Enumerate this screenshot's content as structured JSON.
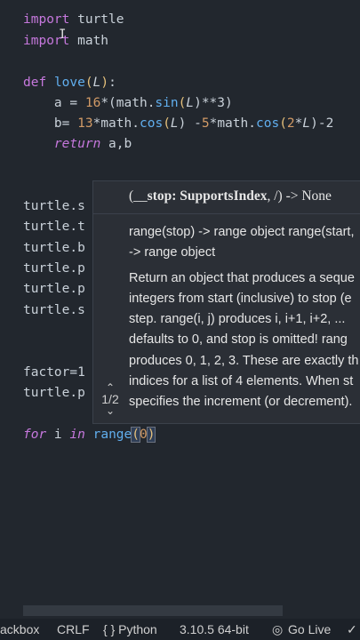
{
  "code": {
    "l1": {
      "kw": "import",
      "mod": " turtle"
    },
    "l2": {
      "kw": "import",
      "mod": " math"
    },
    "l3": {
      "kw": "def",
      "fn": "love",
      "param": "L"
    },
    "l4": {
      "a": "a = ",
      "n16": "16",
      "rest1": "*(math.",
      "sin": "sin",
      "arg": "L",
      "rest2": ")**3)"
    },
    "l5": {
      "b": "b= ",
      "n13": "13",
      "mc1": "*math.",
      "cos1": "cos",
      "arg1": "L",
      "mid": ") -",
      "n5": "5",
      "mc2": "*math.",
      "cos2": "cos",
      "n2": "2",
      "star": "*",
      "arg2": "L",
      "tail": ")-2"
    },
    "l6": {
      "kw": "return",
      "rest": " a,b"
    },
    "t1": "turtle.s",
    "t2": "turtle.t",
    "t3": "turtle.b",
    "t4": "turtle.p",
    "t5": "turtle.p",
    "t6": "turtle.s",
    "f1": "factor=1",
    "t7": "turtle.p",
    "last": {
      "kw1": "for",
      "i": " i ",
      "kw2": "in",
      "fn": " range",
      "arg": "0"
    }
  },
  "hover": {
    "sig_pre": "(__",
    "sig_bold": "stop: SupportsIndex",
    "sig_post": ", /) -> None",
    "lines": [
      "range(stop) -> range object range(start,",
      "-> range object",
      "",
      "Return an object that produces a seque",
      "integers from start (inclusive) to stop (e",
      "step. range(i, j) produces i, i+1, i+2, ...",
      "defaults to 0, and stop is omitted! rang",
      "produces 0, 1, 2, 3. These are exactly th",
      "indices for a list of 4 elements. When st",
      "specifies the increment (or decrement)."
    ],
    "pager": "1/2"
  },
  "status": {
    "items": [
      "ackbox",
      "CRLF",
      "{ } Python",
      "3.10.5 64-bit",
      "Go Live",
      "✓"
    ]
  },
  "colors": {
    "background": "#22272e",
    "keyword": "#c678dd",
    "function": "#61afef",
    "number": "#d19a66"
  }
}
